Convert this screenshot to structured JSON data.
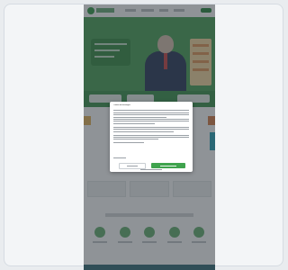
{
  "colors": {
    "brand_green": "#3fa34d",
    "hero_green": "#4fa35b",
    "footer_teal": "#3a6f7a",
    "accent_teal": "#2aa3b8",
    "overlay": "rgba(40,48,56,0.52)"
  },
  "header": {
    "logo_icon": "leaf-logo-icon"
  },
  "consent_dialog": {
    "title": "Cookie-Einstellungen",
    "body_text": "",
    "decline_label": "",
    "accept_label": "",
    "footer_link": ""
  }
}
